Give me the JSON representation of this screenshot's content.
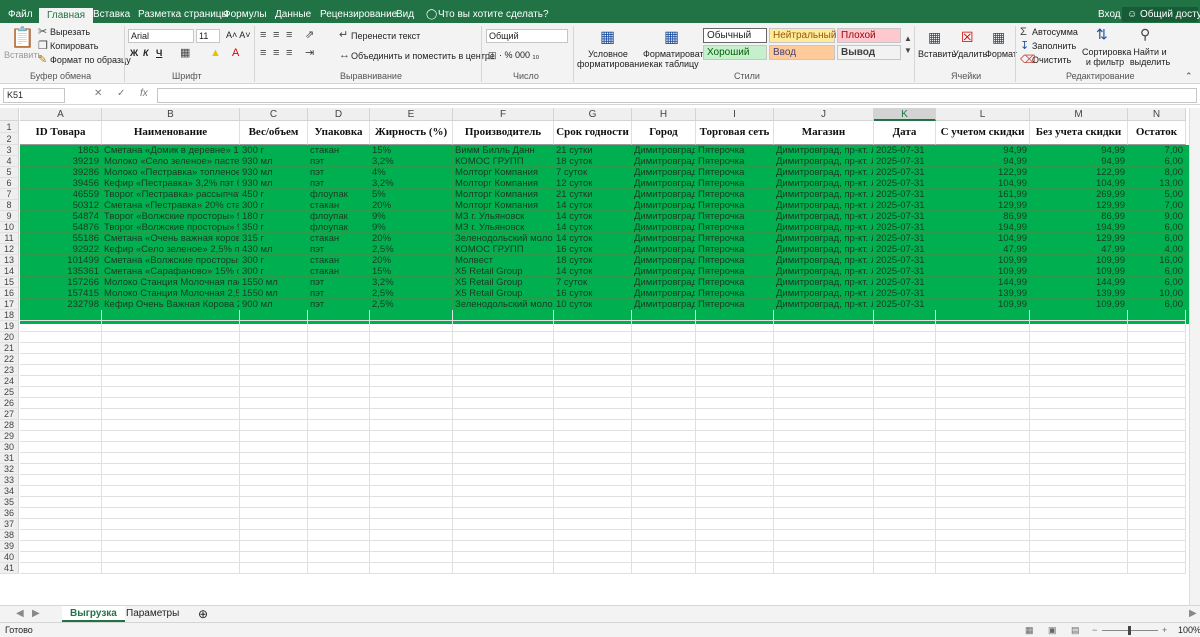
{
  "menu": {
    "tabs": [
      "Файл",
      "Главная",
      "Вставка",
      "Разметка страницы",
      "Формулы",
      "Данные",
      "Рецензирование",
      "Вид"
    ],
    "tell_me": "Что вы хотите сделать?",
    "login": "Вход",
    "share": "Общий доступ"
  },
  "ribbon": {
    "clipboard": {
      "paste": "Вставить",
      "cut": "Вырезать",
      "copy": "Копировать",
      "format_painter": "Формат по образцу",
      "label": "Буфер обмена"
    },
    "font": {
      "name": "Arial",
      "size": "11",
      "bold": "Ж",
      "italic": "К",
      "underline": "Ч",
      "label": "Шрифт"
    },
    "alignment": {
      "wrap": "Перенести текст",
      "merge": "Объединить и поместить в центре",
      "label": "Выравнивание"
    },
    "number": {
      "format": "Общий",
      "label": "Число"
    },
    "styles": {
      "conditional": "Условное форматирование",
      "as_table": "Форматировать как таблицу",
      "cells": [
        "Обычный",
        "Нейтральный",
        "Плохой",
        "Хороший",
        "Ввод",
        "Вывод"
      ],
      "label": "Стили"
    },
    "cells": {
      "insert": "Вставить",
      "delete": "Удалить",
      "format": "Формат",
      "label": "Ячейки"
    },
    "editing": {
      "autosum": "Автосумма",
      "fill": "Заполнить",
      "clear": "Очистить",
      "sort": "Сортировка и фильтр",
      "find": "Найти и выделить",
      "label": "Редактирование"
    }
  },
  "formula_bar": {
    "name_box": "K51",
    "fx": "fx",
    "content": ""
  },
  "columns": [
    "A",
    "B",
    "C",
    "D",
    "E",
    "F",
    "G",
    "H",
    "I",
    "J",
    "K",
    "L",
    "M",
    "N"
  ],
  "selected_column": "K",
  "row_numbers": [
    "1",
    "2",
    "3",
    "4",
    "5",
    "6",
    "7",
    "8",
    "9",
    "10",
    "11",
    "12",
    "13",
    "14",
    "15",
    "16",
    "17",
    "18",
    "19",
    "20",
    "21",
    "22",
    "23",
    "24",
    "25",
    "26",
    "27",
    "28",
    "29",
    "30",
    "31",
    "32",
    "33",
    "34",
    "35",
    "36",
    "37",
    "38",
    "39",
    "40",
    "41"
  ],
  "table": {
    "headers": [
      "ID Товара",
      "Наименование",
      "Вес/объем",
      "Упаковка",
      "Жирность (%)",
      "Производитель",
      "Срок годности",
      "Город",
      "Торговая сеть",
      "Магазин",
      "Дата",
      "С учетом скидки",
      "Без учета скидки",
      "Остаток"
    ],
    "rows": [
      [
        "1863",
        "Сметана «Домик в деревне» 15",
        "300 г",
        "стакан",
        "15%",
        "Вимм Билль Данн",
        "21 сутки",
        "Димитровград",
        "Пятерочка",
        "Димитровград, пр-кт. Л",
        "2025-07-31",
        "94,99",
        "94,99",
        "7,00"
      ],
      [
        "39219",
        "Молоко «Село зеленое» пастер",
        "930 мл",
        "пэт",
        "3,2%",
        "КОМОС ГРУПП",
        "18 суток",
        "Димитровград",
        "Пятерочка",
        "Димитровград, пр-кт. Л",
        "2025-07-31",
        "94,99",
        "94,99",
        "6,00"
      ],
      [
        "39286",
        "Молоко «Пестравка» топленое",
        "930 мл",
        "пэт",
        "4%",
        "Молторг Компания",
        "7 суток",
        "Димитровград",
        "Пятерочка",
        "Димитровград, пр-кт. Л",
        "2025-07-31",
        "122,99",
        "122,99",
        "8,00"
      ],
      [
        "39456",
        "Кефир «Пестравка» 3,2% пэт б",
        "930 мл",
        "пэт",
        "3,2%",
        "Молторг Компания",
        "12 суток",
        "Димитровград",
        "Пятерочка",
        "Димитровград, пр-кт. Л",
        "2025-07-31",
        "104,99",
        "104,99",
        "13,00"
      ],
      [
        "46559",
        "Творог «Пестравка» рассыпчат",
        "450 г",
        "флоупак",
        "5%",
        "Молторг Компания",
        "21 сутки",
        "Димитровград",
        "Пятерочка",
        "Димитровград, пр-кт. Л",
        "2025-07-31",
        "161,99",
        "269,99",
        "5,00"
      ],
      [
        "50312",
        "Сметана «Пестравка» 20% ста",
        "300 г",
        "стакан",
        "20%",
        "Молторг Компания",
        "14 суток",
        "Димитровград",
        "Пятерочка",
        "Димитровград, пр-кт. Л",
        "2025-07-31",
        "129,99",
        "129,99",
        "7,00"
      ],
      [
        "54874",
        "Творог «Волжские просторы» 9",
        "180 г",
        "флоупак",
        "9%",
        "МЗ г. Ульяновск",
        "14 суток",
        "Димитровград",
        "Пятерочка",
        "Димитровград, пр-кт. Л",
        "2025-07-31",
        "86,99",
        "86,99",
        "9,00"
      ],
      [
        "54876",
        "Творог «Волжские просторы» 9",
        "350 г",
        "флоупак",
        "9%",
        "МЗ г. Ульяновск",
        "14 суток",
        "Димитровград",
        "Пятерочка",
        "Димитровград, пр-кт. Л",
        "2025-07-31",
        "194,99",
        "194,99",
        "6,00"
      ],
      [
        "55186",
        "Сметана «Очень важная корова",
        "315 г",
        "стакан",
        "20%",
        "Зеленодольский моло",
        "14 суток",
        "Димитровград",
        "Пятерочка",
        "Димитровград, пр-кт. Л",
        "2025-07-31",
        "104,99",
        "129,99",
        "6,00"
      ],
      [
        "92922",
        "Кефир «Село зеленое» 2,5% пэ",
        "430 мл",
        "пэт",
        "2,5%",
        "КОМОС ГРУПП",
        "16 суток",
        "Димитровград",
        "Пятерочка",
        "Димитровград, пр-кт. Л",
        "2025-07-31",
        "47,99",
        "47,99",
        "4,00"
      ],
      [
        "101499",
        "Сметана «Волжские просторы»",
        "300 г",
        "стакан",
        "20%",
        "Молвест",
        "18 суток",
        "Димитровград",
        "Пятерочка",
        "Димитровград, пр-кт. Л",
        "2025-07-31",
        "109,99",
        "109,99",
        "16,00"
      ],
      [
        "135361",
        "Сметана «Сарафаново» 15% с",
        "300 г",
        "стакан",
        "15%",
        "X5 Retail Group",
        "14 суток",
        "Димитровград",
        "Пятерочка",
        "Димитровград, пр-кт. Л",
        "2025-07-31",
        "109,99",
        "109,99",
        "6,00"
      ],
      [
        "157266",
        "Молоко Станция Молочная паст",
        "1550 мл",
        "пэт",
        "3,2%",
        "X5 Retail Group",
        "7 суток",
        "Димитровград",
        "Пятерочка",
        "Димитровград, пр-кт. Л",
        "2025-07-31",
        "144,99",
        "144,99",
        "6,00"
      ],
      [
        "157415",
        "Молоко Станция Молочная 2,5%",
        "1550 мл",
        "пэт",
        "2,5%",
        "X5 Retail Group",
        "16 суток",
        "Димитровград",
        "Пятерочка",
        "Димитровград, пр-кт. Л",
        "2025-07-31",
        "139,99",
        "139,99",
        "10,00"
      ],
      [
        "232798",
        "Кефир Очень Важная Корова 2,",
        "900 мл",
        "пэт",
        "2,5%",
        "Зеленодольский моло",
        "10 суток",
        "Димитровград",
        "Пятерочка",
        "Димитровград, пр-кт. Л",
        "2025-07-31",
        "109,99",
        "109,99",
        "6,00"
      ]
    ]
  },
  "sheets": {
    "tabs": [
      "Выгрузка",
      "Параметры"
    ],
    "active": "Выгрузка",
    "add": "⊕"
  },
  "status": {
    "ready": "Готово",
    "zoom": "100%"
  },
  "colors": {
    "accent": "#217346",
    "row_fill": "#00b050"
  }
}
